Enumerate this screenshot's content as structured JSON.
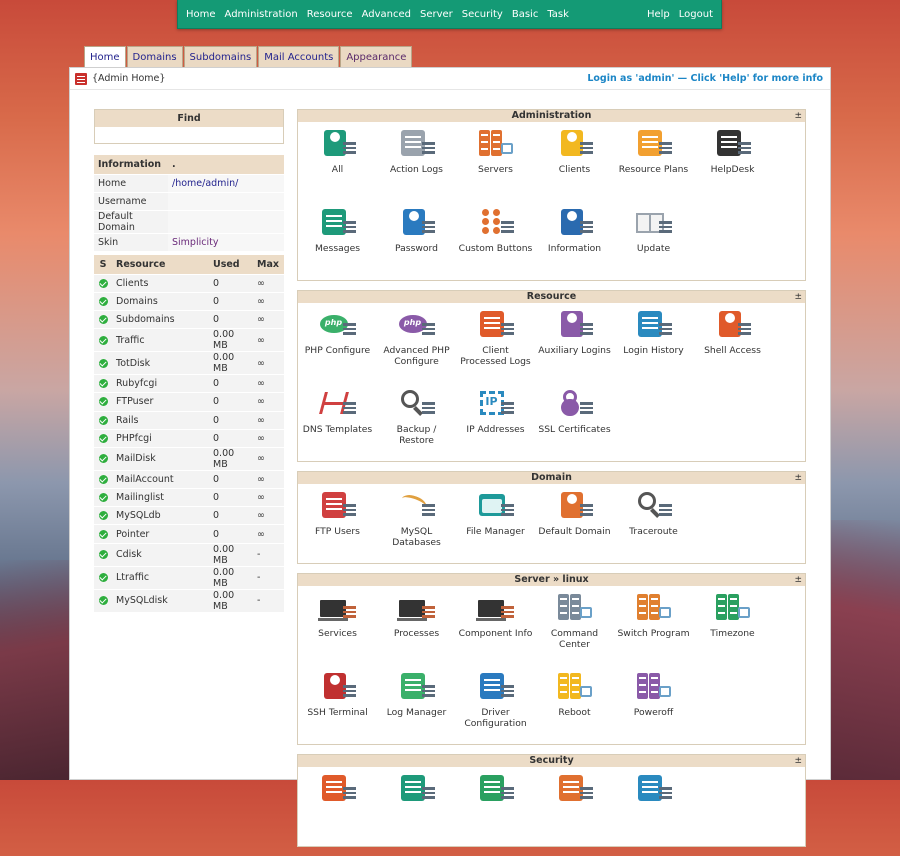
{
  "topnav": {
    "left": [
      "Home",
      "Administration",
      "Resource",
      "Advanced",
      "Server",
      "Security",
      "Basic",
      "Task"
    ],
    "right": [
      "Help",
      "Logout"
    ]
  },
  "tabs": [
    "Home",
    "Domains",
    "Subdomains",
    "Mail Accounts",
    "Appearance"
  ],
  "header": {
    "crumb": "{Admin Home}",
    "login": "Login as 'admin' — Click 'Help' for more info"
  },
  "find": {
    "title": "Find"
  },
  "info": {
    "head_k": "Information",
    "head_v": ".",
    "rows": [
      {
        "k": "Home",
        "v": "/home/admin/"
      },
      {
        "k": "Username",
        "v": ""
      },
      {
        "k": "Default Domain",
        "v": ""
      },
      {
        "k": "Skin",
        "v": "Simplicity"
      }
    ]
  },
  "resources": {
    "headers": [
      "S",
      "Resource",
      "Used",
      "Max"
    ],
    "rows": [
      [
        "Clients",
        "0",
        "∞"
      ],
      [
        "Domains",
        "0",
        "∞"
      ],
      [
        "Subdomains",
        "0",
        "∞"
      ],
      [
        "Traffic",
        "0.00 MB",
        "∞"
      ],
      [
        "TotDisk",
        "0.00 MB",
        "∞"
      ],
      [
        "Rubyfcgi",
        "0",
        "∞"
      ],
      [
        "FTPuser",
        "0",
        "∞"
      ],
      [
        "Rails",
        "0",
        "∞"
      ],
      [
        "PHPfcgi",
        "0",
        "∞"
      ],
      [
        "MailDisk",
        "0.00 MB",
        "∞"
      ],
      [
        "MailAccount",
        "0",
        "∞"
      ],
      [
        "Mailinglist",
        "0",
        "∞"
      ],
      [
        "MySQLdb",
        "0",
        "∞"
      ],
      [
        "Pointer",
        "0",
        "∞"
      ],
      [
        "Cdisk",
        "0.00 MB",
        "-"
      ],
      [
        "Ltraffic",
        "0.00 MB",
        "-"
      ],
      [
        "MySQLdisk",
        "0.00 MB",
        "-"
      ]
    ]
  },
  "sections": [
    {
      "title": "Administration",
      "toggle": "±",
      "items": [
        {
          "label": "All",
          "icon": "all-users-icon",
          "color": "#1e9a7a"
        },
        {
          "label": "Action Logs",
          "icon": "action-logs-icon",
          "color": "#9aa3ad"
        },
        {
          "label": "Servers",
          "icon": "servers-icon",
          "color": "#e07030"
        },
        {
          "label": "Clients",
          "icon": "clients-icon",
          "color": "#f2b820"
        },
        {
          "label": "Resource Plans",
          "icon": "resource-plans-icon",
          "color": "#f2a030"
        },
        {
          "label": "HelpDesk",
          "icon": "helpdesk-icon",
          "color": "#333333"
        },
        {
          "label": "Messages",
          "icon": "messages-icon",
          "color": "#1e9a7a"
        },
        {
          "label": "Password",
          "icon": "password-icon",
          "color": "#2a7abf"
        },
        {
          "label": "Custom Buttons",
          "icon": "custom-buttons-icon",
          "color": "#e07030"
        },
        {
          "label": "Information",
          "icon": "information-icon",
          "color": "#2a6aaf"
        },
        {
          "label": "Update",
          "icon": "update-icon",
          "color": "#9aa3ad"
        }
      ]
    },
    {
      "title": "Resource",
      "toggle": "±",
      "items": [
        {
          "label": "PHP Configure",
          "icon": "php-configure-icon",
          "color": "#3ab06a"
        },
        {
          "label": "Advanced PHP Configure",
          "icon": "advanced-php-icon",
          "color": "#8a5aa8"
        },
        {
          "label": "Client Processed Logs",
          "icon": "client-logs-icon",
          "color": "#e05a2a"
        },
        {
          "label": "Auxiliary Logins",
          "icon": "auxiliary-logins-icon",
          "color": "#8a5aa8"
        },
        {
          "label": "Login History",
          "icon": "login-history-icon",
          "color": "#2a8abf"
        },
        {
          "label": "Shell Access",
          "icon": "shell-access-icon",
          "color": "#e05a2a"
        },
        {
          "label": "DNS Templates",
          "icon": "dns-templates-icon",
          "color": "#d04040"
        },
        {
          "label": "Backup / Restore",
          "icon": "backup-restore-icon",
          "color": "#555555"
        },
        {
          "label": "IP Addresses",
          "icon": "ip-addresses-icon",
          "color": "#2a8abf"
        },
        {
          "label": "SSL Certificates",
          "icon": "ssl-certificates-icon",
          "color": "#8a5aa8"
        }
      ]
    },
    {
      "title": "Domain",
      "toggle": "±",
      "items": [
        {
          "label": "FTP Users",
          "icon": "ftp-users-icon",
          "color": "#d04040"
        },
        {
          "label": "MySQL Databases",
          "icon": "mysql-databases-icon",
          "color": "#e0a040"
        },
        {
          "label": "File Manager",
          "icon": "file-manager-icon",
          "color": "#1e9a9a"
        },
        {
          "label": "Default Domain",
          "icon": "default-domain-icon",
          "color": "#e07030"
        },
        {
          "label": "Traceroute",
          "icon": "traceroute-icon",
          "color": "#555555"
        }
      ]
    },
    {
      "title": "Server » linux",
      "toggle": "±",
      "items": [
        {
          "label": "Services",
          "icon": "services-icon",
          "color": "#333333"
        },
        {
          "label": "Processes",
          "icon": "processes-icon",
          "color": "#333333"
        },
        {
          "label": "Component Info",
          "icon": "component-info-icon",
          "color": "#333333"
        },
        {
          "label": "Command Center",
          "icon": "command-center-icon",
          "color": "#7a8a9a"
        },
        {
          "label": "Switch Program",
          "icon": "switch-program-icon",
          "color": "#e08030"
        },
        {
          "label": "Timezone",
          "icon": "timezone-icon",
          "color": "#2aa060"
        },
        {
          "label": "SSH Terminal",
          "icon": "ssh-terminal-icon",
          "color": "#c03030"
        },
        {
          "label": "Log Manager",
          "icon": "log-manager-icon",
          "color": "#3ab06a"
        },
        {
          "label": "Driver Configuration",
          "icon": "driver-configuration-icon",
          "color": "#2a7abf"
        },
        {
          "label": "Reboot",
          "icon": "reboot-icon",
          "color": "#f2b820"
        },
        {
          "label": "Poweroff",
          "icon": "poweroff-icon",
          "color": "#8a5aa8"
        }
      ]
    },
    {
      "title": "Security",
      "toggle": "±",
      "items": [
        {
          "label": "",
          "icon": "security-1-icon",
          "color": "#e05a2a"
        },
        {
          "label": "",
          "icon": "security-2-icon",
          "color": "#1e9a7a"
        },
        {
          "label": "",
          "icon": "security-3-icon",
          "color": "#2aa060"
        },
        {
          "label": "",
          "icon": "security-4-icon",
          "color": "#e07030"
        },
        {
          "label": "",
          "icon": "security-5-icon",
          "color": "#2a8abf"
        }
      ]
    }
  ]
}
